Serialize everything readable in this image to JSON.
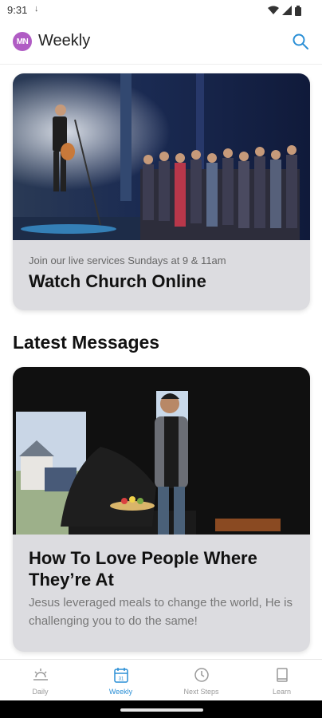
{
  "status_bar": {
    "time": "9:31"
  },
  "app_bar": {
    "avatar_initials": "MN",
    "title": "Weekly"
  },
  "featured": {
    "subtitle": "Join our live services Sundays at 9 & 11am",
    "title": "Watch Church Online"
  },
  "section": {
    "heading": "Latest Messages"
  },
  "message": {
    "title": "How To Love People Where They’re At",
    "description": "Jesus leveraged meals to change the world, He is challenging you to do the same!"
  },
  "bottom_nav": {
    "items": [
      {
        "label": "Daily",
        "icon": "sunrise-icon"
      },
      {
        "label": "Weekly",
        "icon": "calendar-icon"
      },
      {
        "label": "Next Steps",
        "icon": "clock-icon"
      },
      {
        "label": "Learn",
        "icon": "book-icon"
      }
    ],
    "active_index": 1
  },
  "colors": {
    "accent": "#2a8fd6",
    "avatar": "#b05cc4",
    "card_bg": "#dcdce0"
  }
}
